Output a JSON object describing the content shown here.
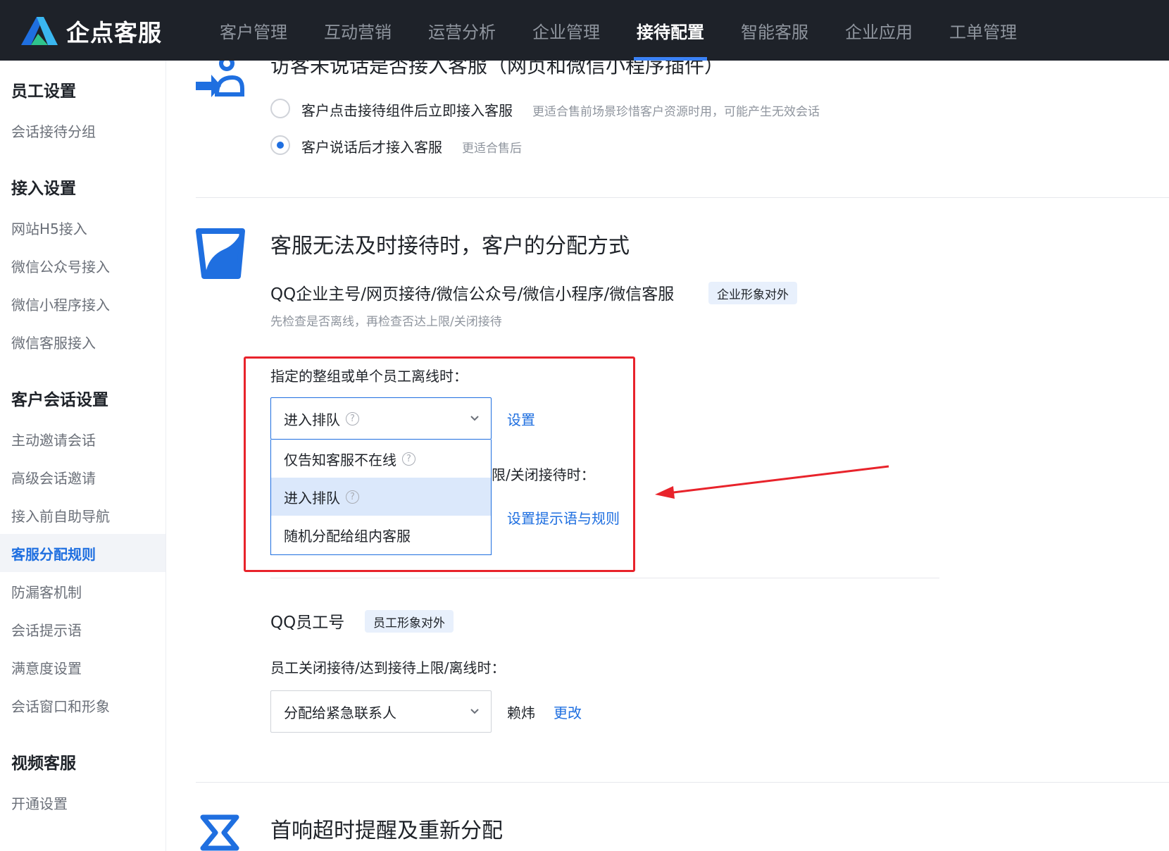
{
  "app": {
    "name": "企点客服"
  },
  "nav": {
    "items": [
      "客户管理",
      "互动营销",
      "运营分析",
      "企业管理",
      "接待配置",
      "智能客服",
      "企业应用",
      "工单管理"
    ],
    "active": "接待配置"
  },
  "sidebar": {
    "groups": [
      {
        "title": "员工设置",
        "items": [
          "会话接待分组"
        ]
      },
      {
        "title": "接入设置",
        "items": [
          "网站H5接入",
          "微信公众号接入",
          "微信小程序接入",
          "微信客服接入"
        ]
      },
      {
        "title": "客户会话设置",
        "items": [
          "主动邀请会话",
          "高级会话邀请",
          "接入前自助导航",
          "客服分配规则",
          "防漏客机制",
          "会话提示语",
          "满意度设置",
          "会话窗口和形象"
        ]
      },
      {
        "title": "视频客服",
        "items": [
          "开通设置"
        ]
      }
    ],
    "active_item": "客服分配规则"
  },
  "section1": {
    "title": "访客未说话是否接入客服（网页和微信小程序插件）",
    "options": [
      {
        "label": "客户点击接待组件后立即接入客服",
        "hint": "更适合售前场景珍惜客户资源时用，可能产生无效会话",
        "selected": false
      },
      {
        "label": "客户说话后才接入客服",
        "hint": "更适合售后",
        "selected": true
      }
    ]
  },
  "section2": {
    "title": "客服无法及时接待时，客户的分配方式",
    "channel_title": "QQ企业主号/网页接待/微信公众号/微信小程序/微信客服",
    "channel_tag": "企业形象对外",
    "channel_desc": "先检查是否离线，再检查否达上限/关闭接待",
    "offline_label": "指定的整组或单个员工离线时：",
    "offline_select_value": "进入排队",
    "offline_link": "设置",
    "limit_label_partial": "限/关闭接待时：",
    "limit_link": "设置提示语与规则",
    "dropdown_options": [
      "仅告知客服不在线",
      "进入排队",
      "随机分配给组内客服"
    ],
    "dropdown_highlighted": "进入排队",
    "qq_title": "QQ员工号",
    "qq_tag": "员工形象对外",
    "qq_label": "员工关闭接待/达到接待上限/离线时：",
    "qq_select_value": "分配给紧急联系人",
    "qq_contact": "赖炜",
    "qq_link": "更改"
  },
  "section3": {
    "title": "首响超时提醒及重新分配"
  },
  "colors": {
    "accent": "#1f6fe0",
    "annotation": "#e8232b",
    "topbar": "#1e2229"
  },
  "icons": [
    "user-enter-icon",
    "bucket-icon",
    "hourglass-icon",
    "help-icon",
    "chevron-down-icon"
  ]
}
